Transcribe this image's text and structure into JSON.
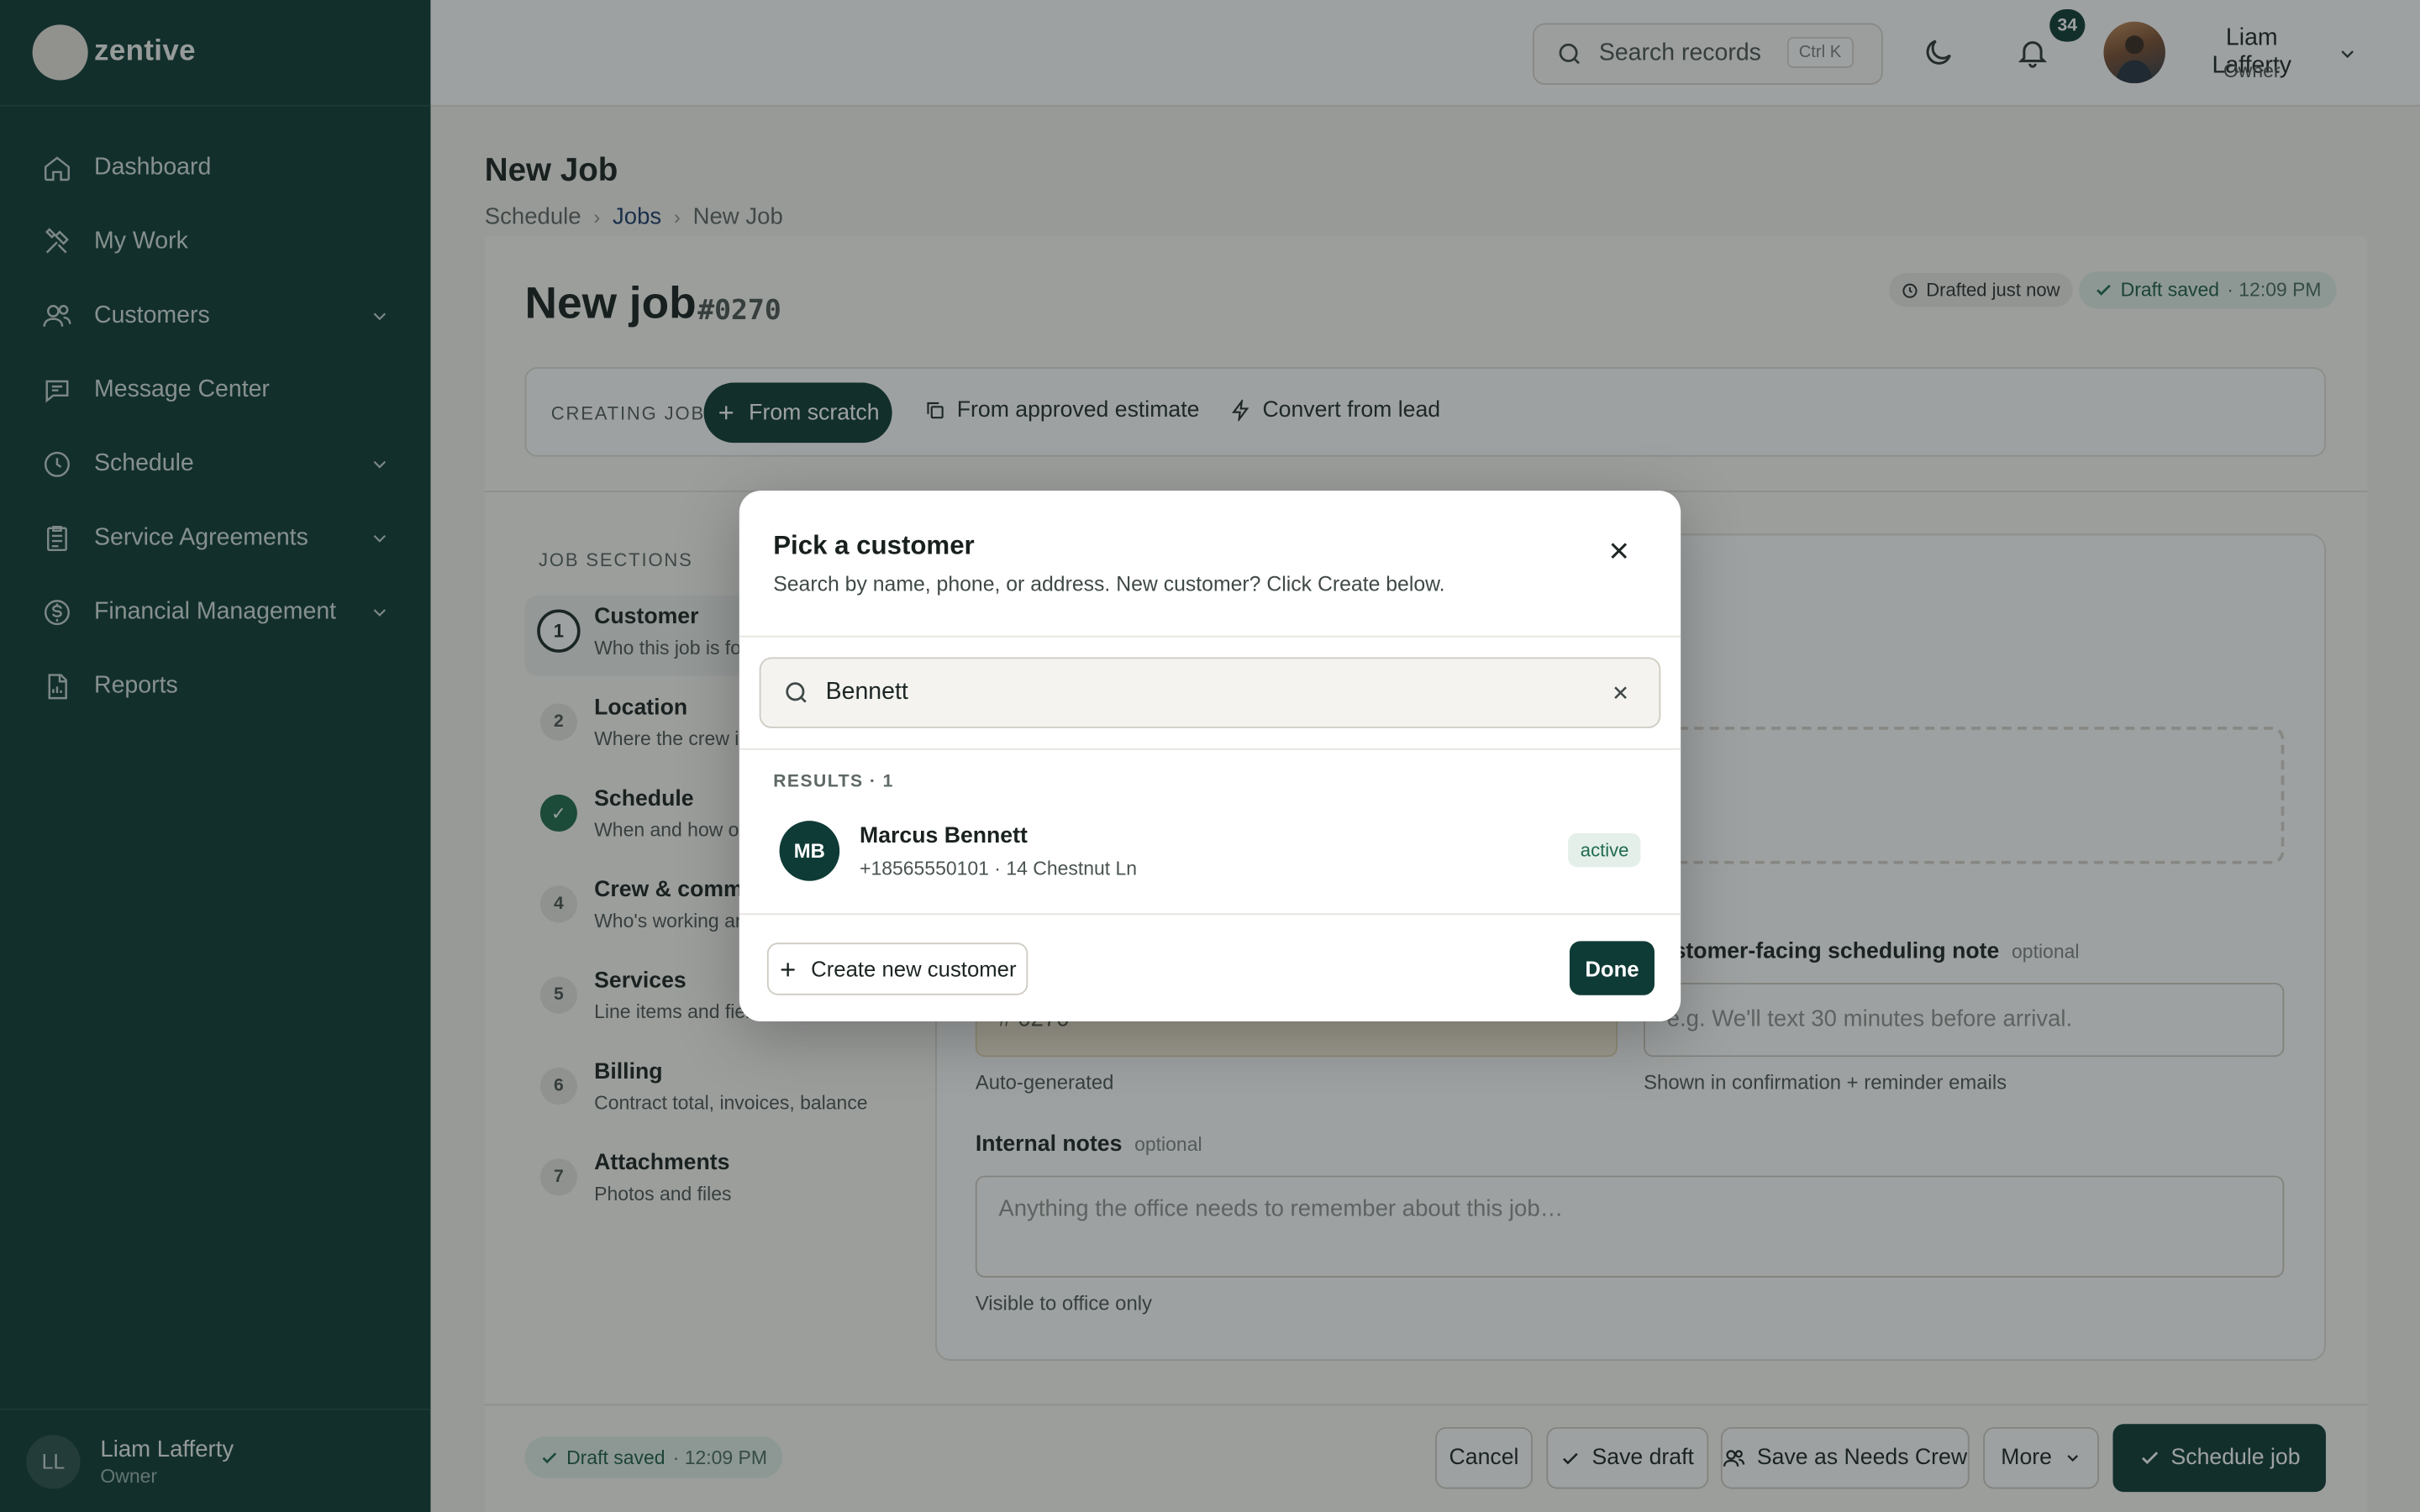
{
  "brand": {
    "name": "zentive"
  },
  "sidebar": {
    "items": [
      {
        "label": "Dashboard",
        "icon": "home-icon",
        "has_children": false
      },
      {
        "label": "My Work",
        "icon": "tools-icon",
        "has_children": false
      },
      {
        "label": "Customers",
        "icon": "users-icon",
        "has_children": true
      },
      {
        "label": "Message Center",
        "icon": "chat-icon",
        "has_children": false
      },
      {
        "label": "Schedule",
        "icon": "clock-icon",
        "has_children": true
      },
      {
        "label": "Service Agreements",
        "icon": "clipboard-icon",
        "has_children": true
      },
      {
        "label": "Financial Management",
        "icon": "dollar-icon",
        "has_children": true
      },
      {
        "label": "Reports",
        "icon": "report-icon",
        "has_children": false
      }
    ],
    "footer": {
      "initials": "LL",
      "name": "Liam Lafferty",
      "role": "Owner"
    }
  },
  "topbar": {
    "search_placeholder": "Search records",
    "shortcut": "Ctrl K",
    "notification_count": "34",
    "user": {
      "name": "Liam Lafferty",
      "role": "Owner"
    }
  },
  "page": {
    "title": "New Job",
    "breadcrumb": [
      "Schedule",
      "Jobs",
      "New Job"
    ]
  },
  "job": {
    "title": "New job",
    "number": "#0270",
    "drafted": "Drafted just now",
    "saved_label": "Draft saved",
    "saved_time": "· 12:09 PM"
  },
  "creating": {
    "label": "CREATING JOB",
    "options": [
      "From scratch",
      "From approved estimate",
      "Convert from lead"
    ]
  },
  "sections": {
    "title": "JOB SECTIONS",
    "items": [
      {
        "num": "1",
        "name": "Customer",
        "desc": "Who this job is for",
        "state": "active"
      },
      {
        "num": "2",
        "name": "Location",
        "desc": "Where the crew is",
        "state": "todo"
      },
      {
        "num": "✓",
        "name": "Schedule",
        "desc": "When and how oft",
        "state": "done"
      },
      {
        "num": "4",
        "name": "Crew & comms",
        "desc": "Who's working an",
        "state": "todo"
      },
      {
        "num": "5",
        "name": "Services",
        "desc": "Line items and field",
        "state": "todo"
      },
      {
        "num": "6",
        "name": "Billing",
        "desc": "Contract total, invoices, balance",
        "state": "todo"
      },
      {
        "num": "7",
        "name": "Attachments",
        "desc": "Photos and files",
        "state": "todo"
      }
    ]
  },
  "form": {
    "job_number_value": "# 0270",
    "job_number_help": "Auto-generated",
    "note_label": "Customer-facing scheduling note",
    "note_optional": "optional",
    "note_placeholder": "e.g. We'll text 30 minutes before arrival.",
    "note_help": "Shown in confirmation + reminder emails",
    "internal_label": "Internal notes",
    "internal_optional": "optional",
    "internal_placeholder": "Anything the office needs to remember about this job…",
    "internal_help": "Visible to office only"
  },
  "bottom": {
    "saved_label": "Draft saved",
    "saved_time": "· 12:09 PM",
    "cancel": "Cancel",
    "save_draft": "Save draft",
    "save_needs_crew": "Save as Needs Crew",
    "more": "More",
    "schedule": "Schedule job"
  },
  "modal": {
    "title": "Pick a customer",
    "subtitle": "Search by name, phone, or address. New customer? Click Create below.",
    "search_value": "Bennett",
    "results_label": "RESULTS · 1",
    "results": [
      {
        "initials": "MB",
        "name": "Marcus Bennett",
        "meta": "+18565550101 · 14 Chestnut Ln",
        "status": "active"
      }
    ],
    "create_label": "Create new customer",
    "done_label": "Done"
  },
  "colors": {
    "brand": "#0f3b36",
    "active_badge": "#1f6b4f"
  }
}
